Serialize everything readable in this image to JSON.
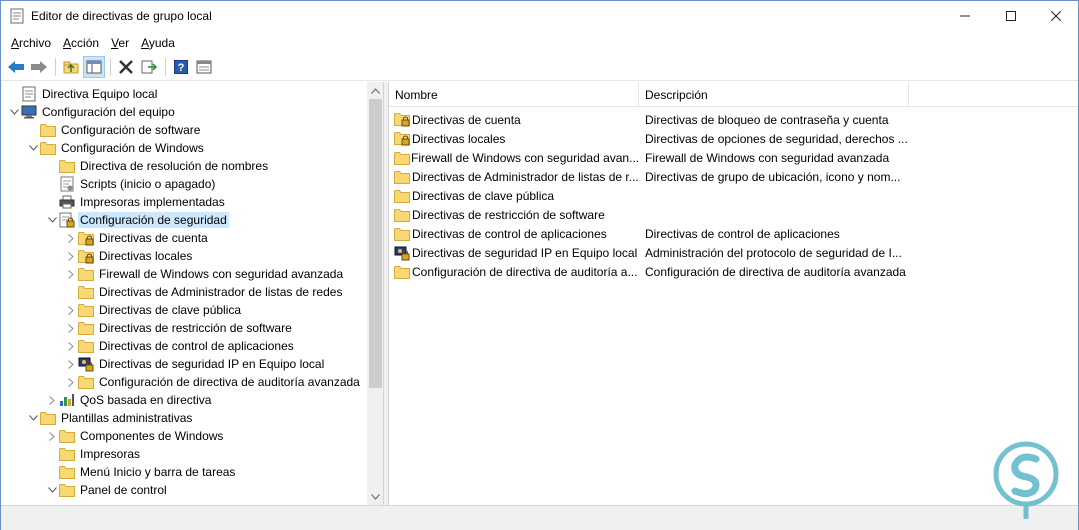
{
  "window": {
    "title": "Editor de directivas de grupo local",
    "minimize_icon": "minimize-icon",
    "maximize_icon": "maximize-icon",
    "close_icon": "close-icon"
  },
  "menu": [
    {
      "label": "Archivo"
    },
    {
      "label": "Acción"
    },
    {
      "label": "Ver"
    },
    {
      "label": "Ayuda"
    }
  ],
  "toolbar": {
    "buttons": [
      "back-arrow-icon",
      "forward-arrow-icon",
      "up-folder-icon",
      "show-hide-tree-icon",
      "delete-icon",
      "export-list-icon",
      "help-icon",
      "properties-icon"
    ]
  },
  "tree": {
    "items": [
      {
        "label": "Directiva Equipo local",
        "level": 0,
        "expander": "",
        "icon": "policy-document-icon"
      },
      {
        "label": "Configuración del equipo",
        "level": 0,
        "expander": "expanded",
        "icon": "computer-icon"
      },
      {
        "label": "Configuración de software",
        "level": 1,
        "expander": "",
        "icon": "folder-icon"
      },
      {
        "label": "Configuración de Windows",
        "level": 1,
        "expander": "expanded",
        "icon": "folder-icon"
      },
      {
        "label": "Directiva de resolución de nombres",
        "level": 2,
        "expander": "",
        "icon": "folder-icon"
      },
      {
        "label": "Scripts (inicio o apagado)",
        "level": 2,
        "expander": "",
        "icon": "script-icon"
      },
      {
        "label": "Impresoras implementadas",
        "level": 2,
        "expander": "",
        "icon": "printer-icon"
      },
      {
        "label": "Configuración de seguridad",
        "level": 2,
        "expander": "expanded",
        "icon": "security-settings-icon",
        "selected": true
      },
      {
        "label": "Directivas de cuenta",
        "level": 3,
        "expander": "collapsed",
        "icon": "locked-folder-icon"
      },
      {
        "label": "Directivas locales",
        "level": 3,
        "expander": "collapsed",
        "icon": "locked-folder-icon"
      },
      {
        "label": "Firewall de Windows con seguridad avanzada",
        "level": 3,
        "expander": "collapsed",
        "icon": "folder-icon"
      },
      {
        "label": "Directivas de Administrador de listas de redes",
        "level": 3,
        "expander": "",
        "icon": "folder-icon"
      },
      {
        "label": "Directivas de clave pública",
        "level": 3,
        "expander": "collapsed",
        "icon": "folder-icon"
      },
      {
        "label": "Directivas de restricción de software",
        "level": 3,
        "expander": "collapsed",
        "icon": "folder-icon"
      },
      {
        "label": "Directivas de control de aplicaciones",
        "level": 3,
        "expander": "collapsed",
        "icon": "folder-icon"
      },
      {
        "label": "Directivas de seguridad IP en Equipo local",
        "level": 3,
        "expander": "collapsed",
        "icon": "ip-security-icon"
      },
      {
        "label": "Configuración de directiva de auditoría avanzada",
        "level": 3,
        "expander": "collapsed",
        "icon": "folder-icon"
      },
      {
        "label": "QoS basada en directiva",
        "level": 2,
        "expander": "collapsed",
        "icon": "qos-chart-icon"
      },
      {
        "label": "Plantillas administrativas",
        "level": 1,
        "expander": "expanded",
        "icon": "folder-icon"
      },
      {
        "label": "Componentes de Windows",
        "level": 2,
        "expander": "collapsed",
        "icon": "folder-icon"
      },
      {
        "label": "Impresoras",
        "level": 2,
        "expander": "",
        "icon": "folder-icon"
      },
      {
        "label": "Menú Inicio y barra de tareas",
        "level": 2,
        "expander": "",
        "icon": "folder-icon"
      },
      {
        "label": "Panel de control",
        "level": 2,
        "expander": "expanded",
        "icon": "folder-icon"
      }
    ]
  },
  "list": {
    "columns": [
      "Nombre",
      "Descripción"
    ],
    "rows": [
      {
        "name": "Directivas de cuenta",
        "desc": "Directivas de bloqueo de contraseña y cuenta",
        "icon": "locked-folder-icon"
      },
      {
        "name": "Directivas locales",
        "desc": "Directivas de opciones de seguridad, derechos ...",
        "icon": "locked-folder-icon"
      },
      {
        "name": "Firewall de Windows con seguridad avan...",
        "desc": "Firewall de Windows con seguridad avanzada",
        "icon": "folder-icon"
      },
      {
        "name": "Directivas de Administrador de listas de r...",
        "desc": "Directivas de grupo de ubicación, icono y nom...",
        "icon": "folder-icon"
      },
      {
        "name": "Directivas de clave pública",
        "desc": "",
        "icon": "folder-icon"
      },
      {
        "name": "Directivas de restricción de software",
        "desc": "",
        "icon": "folder-icon"
      },
      {
        "name": "Directivas de control de aplicaciones",
        "desc": "Directivas de control de aplicaciones",
        "icon": "folder-icon"
      },
      {
        "name": "Directivas de seguridad IP en Equipo local",
        "desc": "Administración del protocolo de seguridad de I...",
        "icon": "ip-security-icon"
      },
      {
        "name": "Configuración de directiva de auditoría a...",
        "desc": "Configuración de directiva de auditoría avanzada",
        "icon": "folder-icon"
      }
    ]
  },
  "colors": {
    "selection": "#cce8ff",
    "folder": "#f8d775",
    "border": "#d4d4d4",
    "watermark": "#5bb6c9"
  }
}
